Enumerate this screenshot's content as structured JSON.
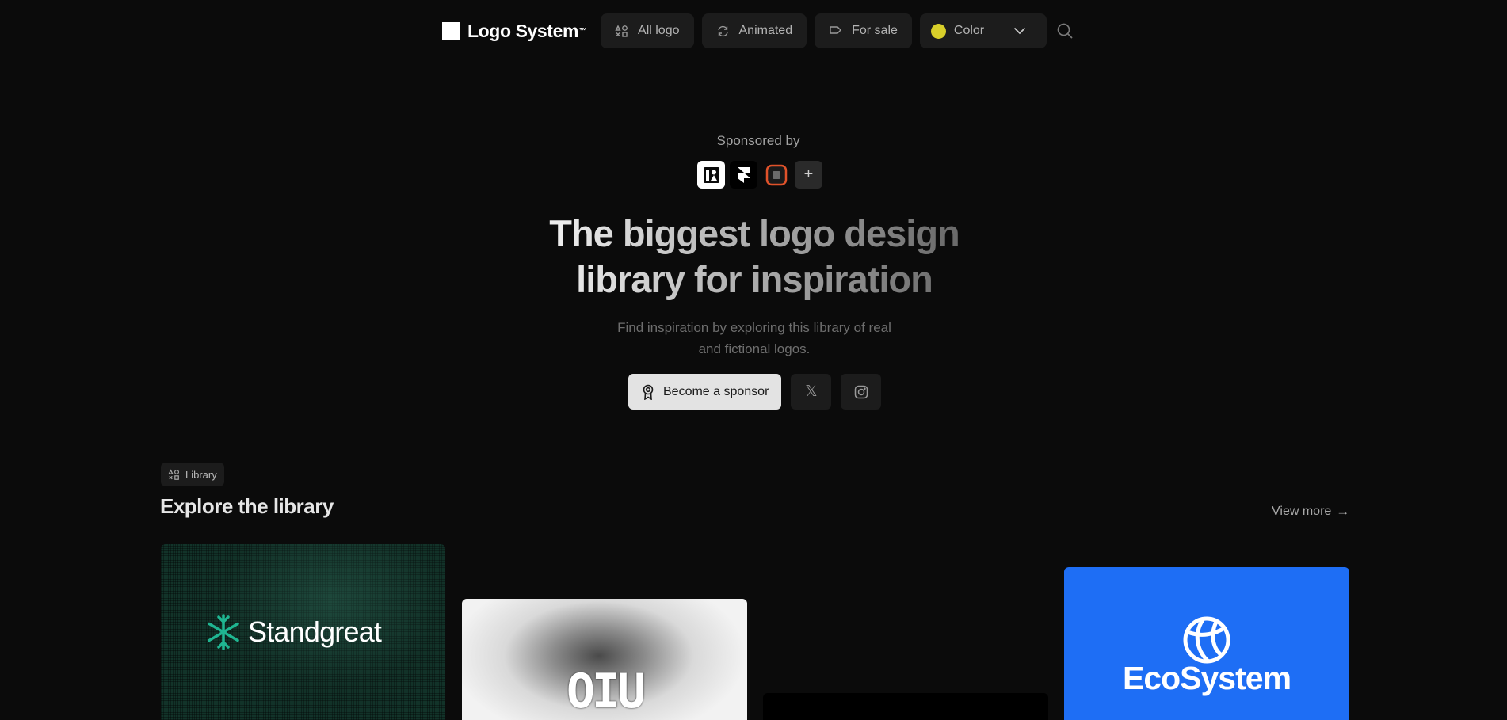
{
  "brand": {
    "name": "Logo System",
    "tm": "™"
  },
  "nav": {
    "all_logo": "All logo",
    "animated": "Animated",
    "for_sale": "For sale",
    "color": {
      "label": "Color",
      "swatch": "#d8cf2a"
    }
  },
  "hero": {
    "sponsored_by": "Sponsored by",
    "sponsors": [
      "sponsor-logo-1",
      "framer-logo",
      "sponsor-logo-3",
      "add-sponsor"
    ],
    "add_sponsor_symbol": "+",
    "headline_line1": "The biggest logo design",
    "headline_line2": "library for inspiration",
    "sub_line1": "Find inspiration by exploring this library of real",
    "sub_line2": "and fictional logos.",
    "cta_label": "Become a sponsor",
    "x_symbol": "𝕏"
  },
  "library": {
    "badge": "Library",
    "title": "Explore the library",
    "view_more": "View more",
    "view_more_arrow": "→",
    "cards": [
      {
        "name": "Standgreat",
        "accent": "#1fb591"
      },
      {
        "name": "OIU"
      },
      {
        "name": ""
      },
      {
        "name": "EcoSystem",
        "background": "#1e6ef5"
      }
    ]
  }
}
